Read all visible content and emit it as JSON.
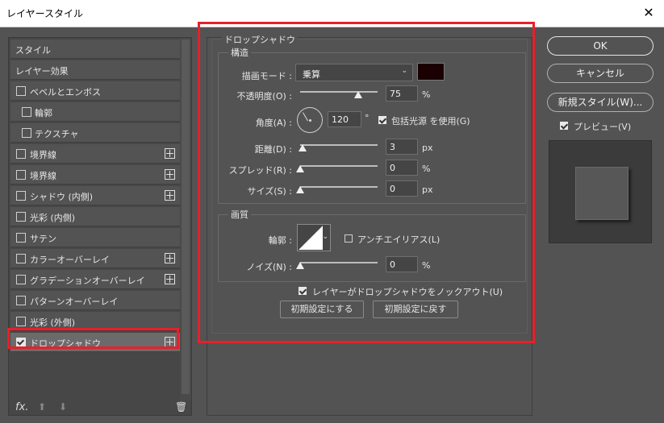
{
  "window": {
    "title": "レイヤースタイル",
    "close_glyph": "✕"
  },
  "left_panel": {
    "items": [
      {
        "label": "スタイル",
        "checkbox": false,
        "checked": false,
        "plus": false,
        "indent": false
      },
      {
        "label": "レイヤー効果",
        "checkbox": false,
        "checked": false,
        "plus": false,
        "indent": false
      },
      {
        "label": "ベベルとエンボス",
        "checkbox": true,
        "checked": false,
        "plus": false,
        "indent": false
      },
      {
        "label": "輪郭",
        "checkbox": true,
        "checked": false,
        "plus": false,
        "indent": true
      },
      {
        "label": "テクスチャ",
        "checkbox": true,
        "checked": false,
        "plus": false,
        "indent": true
      },
      {
        "label": "境界線",
        "checkbox": true,
        "checked": false,
        "plus": true,
        "indent": false
      },
      {
        "label": "境界線",
        "checkbox": true,
        "checked": false,
        "plus": true,
        "indent": false
      },
      {
        "label": "シャドウ (内側)",
        "checkbox": true,
        "checked": false,
        "plus": true,
        "indent": false
      },
      {
        "label": "光彩 (内側)",
        "checkbox": true,
        "checked": false,
        "plus": false,
        "indent": false
      },
      {
        "label": "サテン",
        "checkbox": true,
        "checked": false,
        "plus": false,
        "indent": false
      },
      {
        "label": "カラーオーバーレイ",
        "checkbox": true,
        "checked": false,
        "plus": true,
        "indent": false
      },
      {
        "label": "グラデーションオーバーレイ",
        "checkbox": true,
        "checked": false,
        "plus": true,
        "indent": false
      },
      {
        "label": "パターンオーバーレイ",
        "checkbox": true,
        "checked": false,
        "plus": false,
        "indent": false
      },
      {
        "label": "光彩 (外側)",
        "checkbox": true,
        "checked": false,
        "plus": false,
        "indent": false
      },
      {
        "label": "ドロップシャドウ",
        "checkbox": true,
        "checked": true,
        "plus": true,
        "indent": false,
        "selected": true
      }
    ],
    "footer": {
      "fx": "fx.",
      "up": "⬆",
      "down": "⬇",
      "trash": "🗑"
    }
  },
  "drop_shadow": {
    "title": "ドロップシャドウ",
    "structure": {
      "legend": "構造",
      "blend_mode_label": "描画モード :",
      "blend_mode_value": "乗算",
      "chevron": "⌄",
      "shadow_color": "#1a0003",
      "opacity_label": "不透明度(O) :",
      "opacity_value": "75",
      "opacity_unit": "%",
      "opacity_level": 75,
      "angle_label": "角度(A) :",
      "angle_value": "120",
      "angle_unit": "°",
      "global_light_label": "包括光源 を使用(G)",
      "global_light_checked": true,
      "distance_label": "距離(D) :",
      "distance_value": "3",
      "distance_unit": "px",
      "spread_label": "スプレッド(R) :",
      "spread_value": "0",
      "spread_unit": "%",
      "size_label": "サイズ(S) :",
      "size_value": "0",
      "size_unit": "px"
    },
    "quality": {
      "legend": "画質",
      "contour_label": "輪郭 :",
      "anti_alias_label": "アンチエイリアス(L)",
      "anti_alias_checked": false,
      "noise_label": "ノイズ(N) :",
      "noise_value": "0",
      "noise_unit": "%"
    },
    "knockout_label": "レイヤーがドロップシャドウをノックアウト(U)",
    "knockout_checked": true,
    "make_default_label": "初期設定にする",
    "reset_default_label": "初期設定に戻す"
  },
  "right_panel": {
    "ok_label": "OK",
    "cancel_label": "キャンセル",
    "new_style_label": "新規スタイル(W)...",
    "preview_label": "プレビュー(V)",
    "preview_checked": true
  },
  "colors": {
    "highlight": "#e8202a",
    "panel_bg": "#535353"
  }
}
